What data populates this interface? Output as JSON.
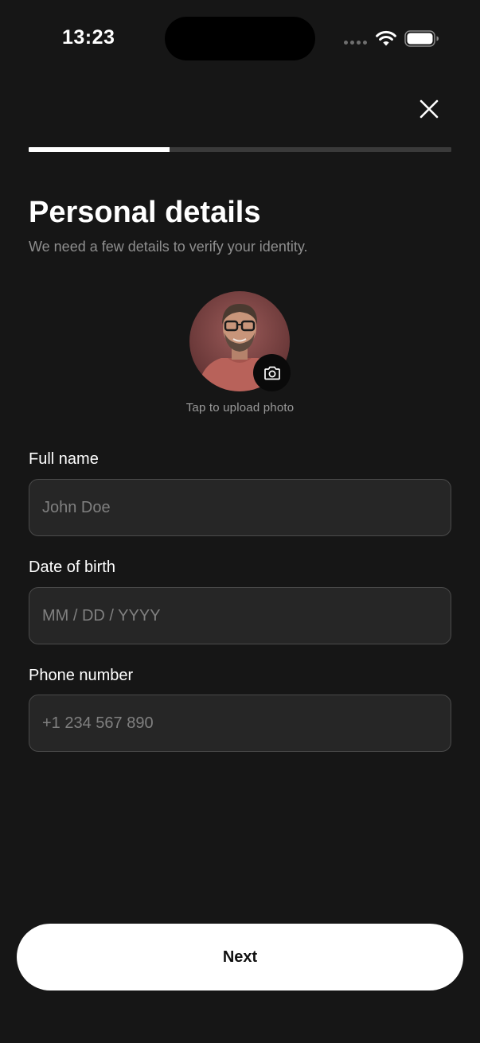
{
  "status_bar": {
    "time": "13:23"
  },
  "header": {
    "close_icon": "close-icon",
    "progress": 0.333
  },
  "title": "Personal details",
  "subtitle": "We need a few details to verify your identity.",
  "avatar": {
    "camera_icon": "camera-icon",
    "upload_hint": "Tap to upload photo"
  },
  "form": {
    "full_name": {
      "label": "Full name",
      "value": "",
      "placeholder": "John Doe"
    },
    "date_of_birth": {
      "label": "Date of birth",
      "value": "",
      "placeholder": "MM / DD / YYYY"
    },
    "phone_number": {
      "label": "Phone number",
      "value": "",
      "placeholder": "+1 234 567 890"
    }
  },
  "next_button": {
    "label": "Next"
  },
  "colors": {
    "background": "#161616",
    "input_background": "#262626",
    "input_border": "#4a4a4a",
    "primary_button": "#ffffff",
    "muted_text": "#8e8e8e"
  }
}
